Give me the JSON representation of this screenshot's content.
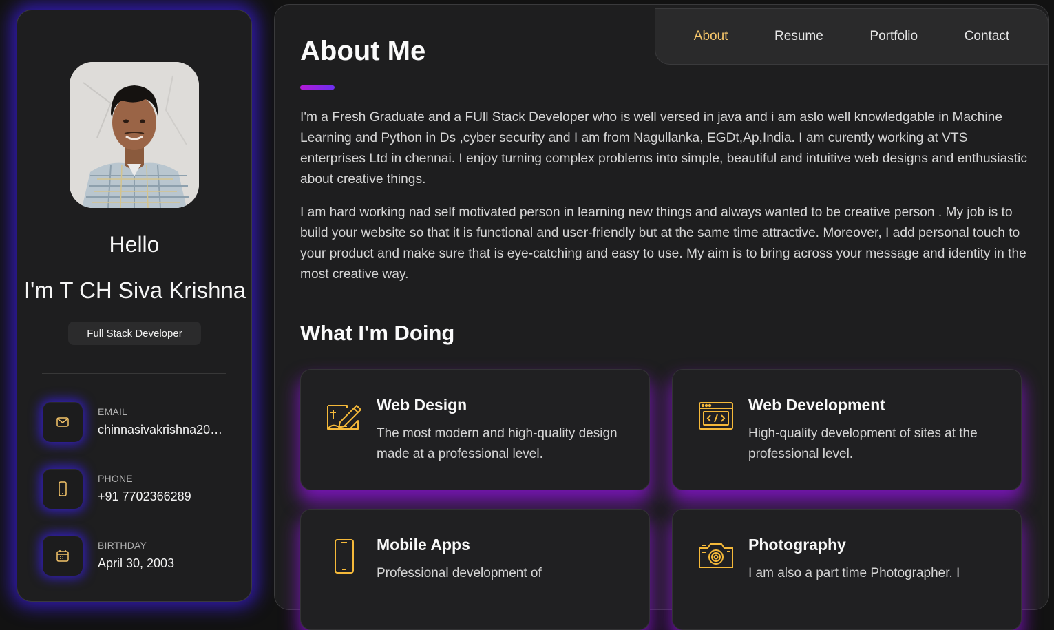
{
  "sidebar": {
    "hello": "Hello",
    "name": "I'm T CH Siva Krishna",
    "role": "Full Stack Developer",
    "contacts": [
      {
        "label": "EMAIL",
        "value": "chinnasivakrishna20…",
        "icon": "mail-icon"
      },
      {
        "label": "PHONE",
        "value": "+91 7702366289",
        "icon": "phone-icon"
      },
      {
        "label": "BIRTHDAY",
        "value": "April 30, 2003",
        "icon": "calendar-icon"
      }
    ]
  },
  "nav": {
    "items": [
      "About",
      "Resume",
      "Portfolio",
      "Contact"
    ],
    "active": "About"
  },
  "about": {
    "title": "About Me",
    "paragraphs": [
      "I'm a Fresh Graduate and a FUll Stack Developer who is well versed in java and i am aslo well knowledgable in Machine Learning and Python in Ds ,cyber security and I am from Nagullanka, EGDt,Ap,India. I am curently working at VTS enterprises Ltd in chennai. I enjoy turning complex problems into simple, beautiful and intuitive web designs and enthusiastic about creative things.",
      "I am hard working nad self motivated person in learning new things and always wanted to be creative person . My job is to build your website so that it is functional and user-friendly but at the same time attractive. Moreover, I add personal touch to your product and make sure that is eye-catching and easy to use. My aim is to bring across your message and identity in the most creative way."
    ]
  },
  "services": {
    "title": "What I'm Doing",
    "items": [
      {
        "title": "Web Design",
        "text": "The most modern and high-quality design made at a professional level.",
        "icon": "web-design-icon"
      },
      {
        "title": "Web Development",
        "text": "High-quality development of sites at the professional level.",
        "icon": "code-window-icon"
      },
      {
        "title": "Mobile Apps",
        "text": "Professional development of",
        "icon": "mobile-icon"
      },
      {
        "title": "Photography",
        "text": "I am also a part time Photographer. I",
        "icon": "camera-icon"
      }
    ]
  },
  "colors": {
    "accent": "#f5c56a",
    "glow_blue": "#3c1ee6",
    "glow_purple": "#8214c8",
    "card_bg": "#1e1e1f"
  }
}
